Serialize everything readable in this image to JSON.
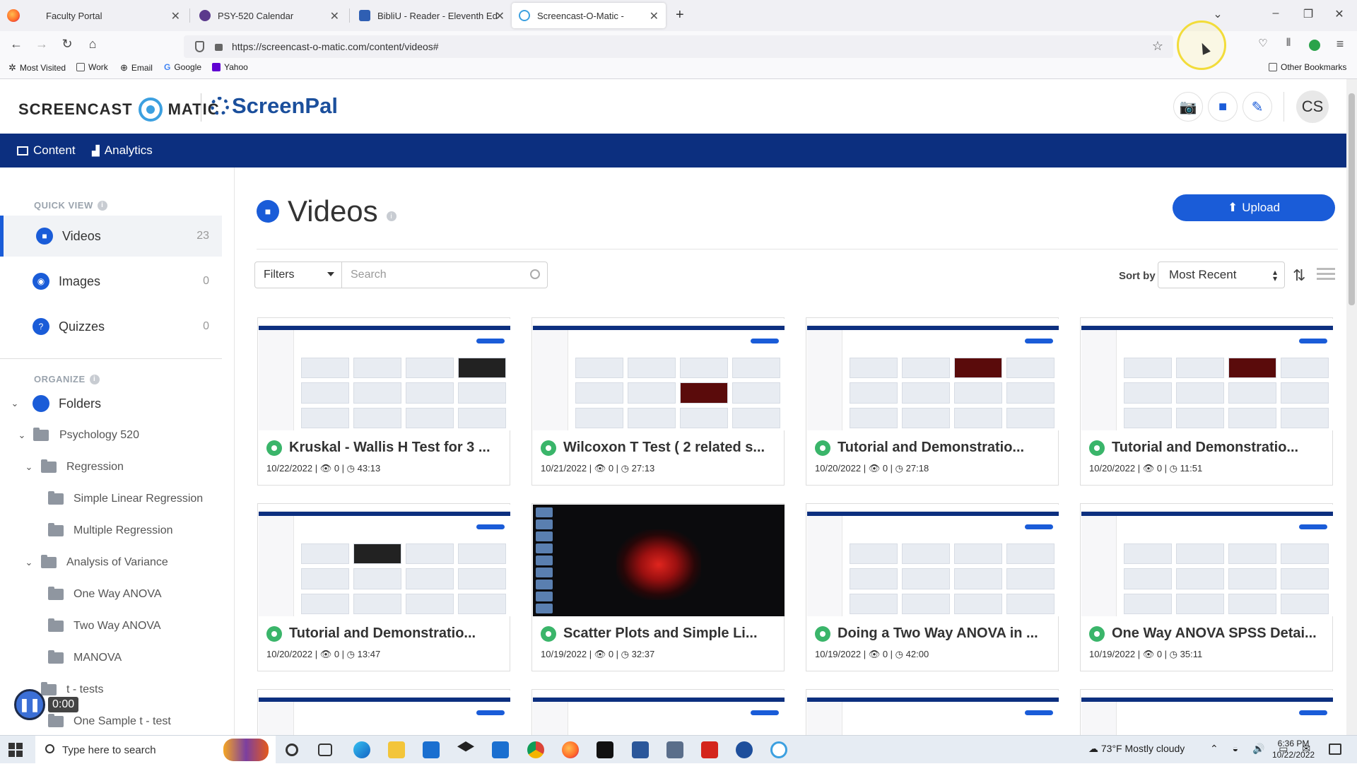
{
  "browser": {
    "tabs": [
      {
        "label": "Faculty Portal"
      },
      {
        "label": "PSY-520 Calendar"
      },
      {
        "label": "BibliU - Reader - Eleventh Editio"
      },
      {
        "label": "Screencast-O-Matic -"
      }
    ],
    "url": "https://screencast-o-matic.com/content/videos#",
    "bookmarks": [
      "Most Visited",
      "Work",
      "Email",
      "Google",
      "Yahoo"
    ],
    "other_bookmarks": "Other Bookmarks"
  },
  "header": {
    "logo_text_1": "SCREENCAST",
    "logo_text_2": "MATIC",
    "logo_brand": "ScreenPal",
    "avatar_initials": "CS"
  },
  "mainnav": {
    "content": "Content",
    "analytics": "Analytics"
  },
  "sidebar": {
    "quick_view": "QUICK VIEW",
    "organize": "ORGANIZE",
    "items": [
      {
        "label": "Videos",
        "count": "23"
      },
      {
        "label": "Images",
        "count": "0"
      },
      {
        "label": "Quizzes",
        "count": "0"
      }
    ],
    "folders_label": "Folders",
    "tree": [
      "Psychology 520",
      "Regression",
      "Simple Linear Regression",
      "Multiple Regression",
      "Analysis of Variance",
      "One Way ANOVA",
      "Two Way ANOVA",
      "MANOVA",
      "t - tests",
      "One Sample t - test"
    ],
    "recorder_time": "0:00"
  },
  "main": {
    "title": "Videos",
    "upload": "Upload",
    "filters": "Filters",
    "search_placeholder": "Search",
    "sort_by": "Sort by",
    "sort_value": "Most Recent"
  },
  "videos": [
    {
      "title": "Kruskal - Wallis H Test for 3 ...",
      "date": "10/22/2022",
      "views": "0",
      "duration": "43:13"
    },
    {
      "title": "Wilcoxon T Test ( 2 related s...",
      "date": "10/21/2022",
      "views": "0",
      "duration": "27:13"
    },
    {
      "title": "Tutorial and Demonstratio...",
      "date": "10/20/2022",
      "views": "0",
      "duration": "27:18"
    },
    {
      "title": "Tutorial and Demonstratio...",
      "date": "10/20/2022",
      "views": "0",
      "duration": "11:51"
    },
    {
      "title": "Tutorial and Demonstratio...",
      "date": "10/20/2022",
      "views": "0",
      "duration": "13:47"
    },
    {
      "title": "Scatter Plots and Simple Li...",
      "date": "10/19/2022",
      "views": "0",
      "duration": "32:37"
    },
    {
      "title": "Doing a Two Way ANOVA in ...",
      "date": "10/19/2022",
      "views": "0",
      "duration": "42:00"
    },
    {
      "title": "One Way ANOVA SPSS Detai...",
      "date": "10/19/2022",
      "views": "0",
      "duration": "35:11"
    }
  ],
  "taskbar": {
    "search": "Type here to search",
    "weather": "73°F  Mostly cloudy",
    "time": "6:36 PM",
    "date": "10/22/2022"
  },
  "colors": {
    "nav": "#0c2f7f",
    "accent": "#1a5cd8",
    "check": "#3ab56a"
  }
}
